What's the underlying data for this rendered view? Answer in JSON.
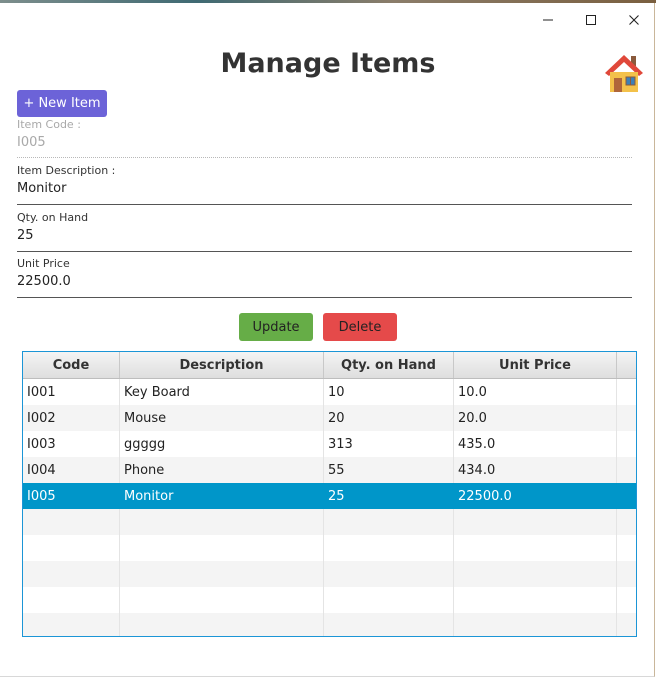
{
  "window": {
    "minimize_icon": "minimize-icon",
    "maximize_icon": "maximize-icon",
    "close_icon": "close-icon"
  },
  "header": {
    "title": "Manage Items",
    "home_icon": "home-icon"
  },
  "toolbar": {
    "new_item_label": "+ New Item",
    "accent": "#6c63d8"
  },
  "form": {
    "item_code": {
      "label": "Item Code :",
      "value": "I005"
    },
    "description": {
      "label": "Item Description :",
      "value": "Monitor"
    },
    "qty": {
      "label": "Qty. on Hand",
      "value": "25"
    },
    "unit_price": {
      "label": "Unit Price",
      "value": "22500.0"
    }
  },
  "actions": {
    "update_label": "Update",
    "update_color": "#66ad47",
    "delete_label": "Delete",
    "delete_color": "#e54a4a"
  },
  "table": {
    "columns": [
      "Code",
      "Description",
      "Qty. on Hand",
      "Unit Price"
    ],
    "rows": [
      [
        "I001",
        "Key Board",
        "10",
        "10.0"
      ],
      [
        "I002",
        "Mouse",
        "20",
        "20.0"
      ],
      [
        "I003",
        "ggggg",
        "313",
        "435.0"
      ],
      [
        "I004",
        "Phone",
        "55",
        "434.0"
      ],
      [
        "I005",
        "Monitor",
        "25",
        "22500.0"
      ]
    ],
    "selected_row": 4,
    "selection_color": "#0096c9"
  }
}
